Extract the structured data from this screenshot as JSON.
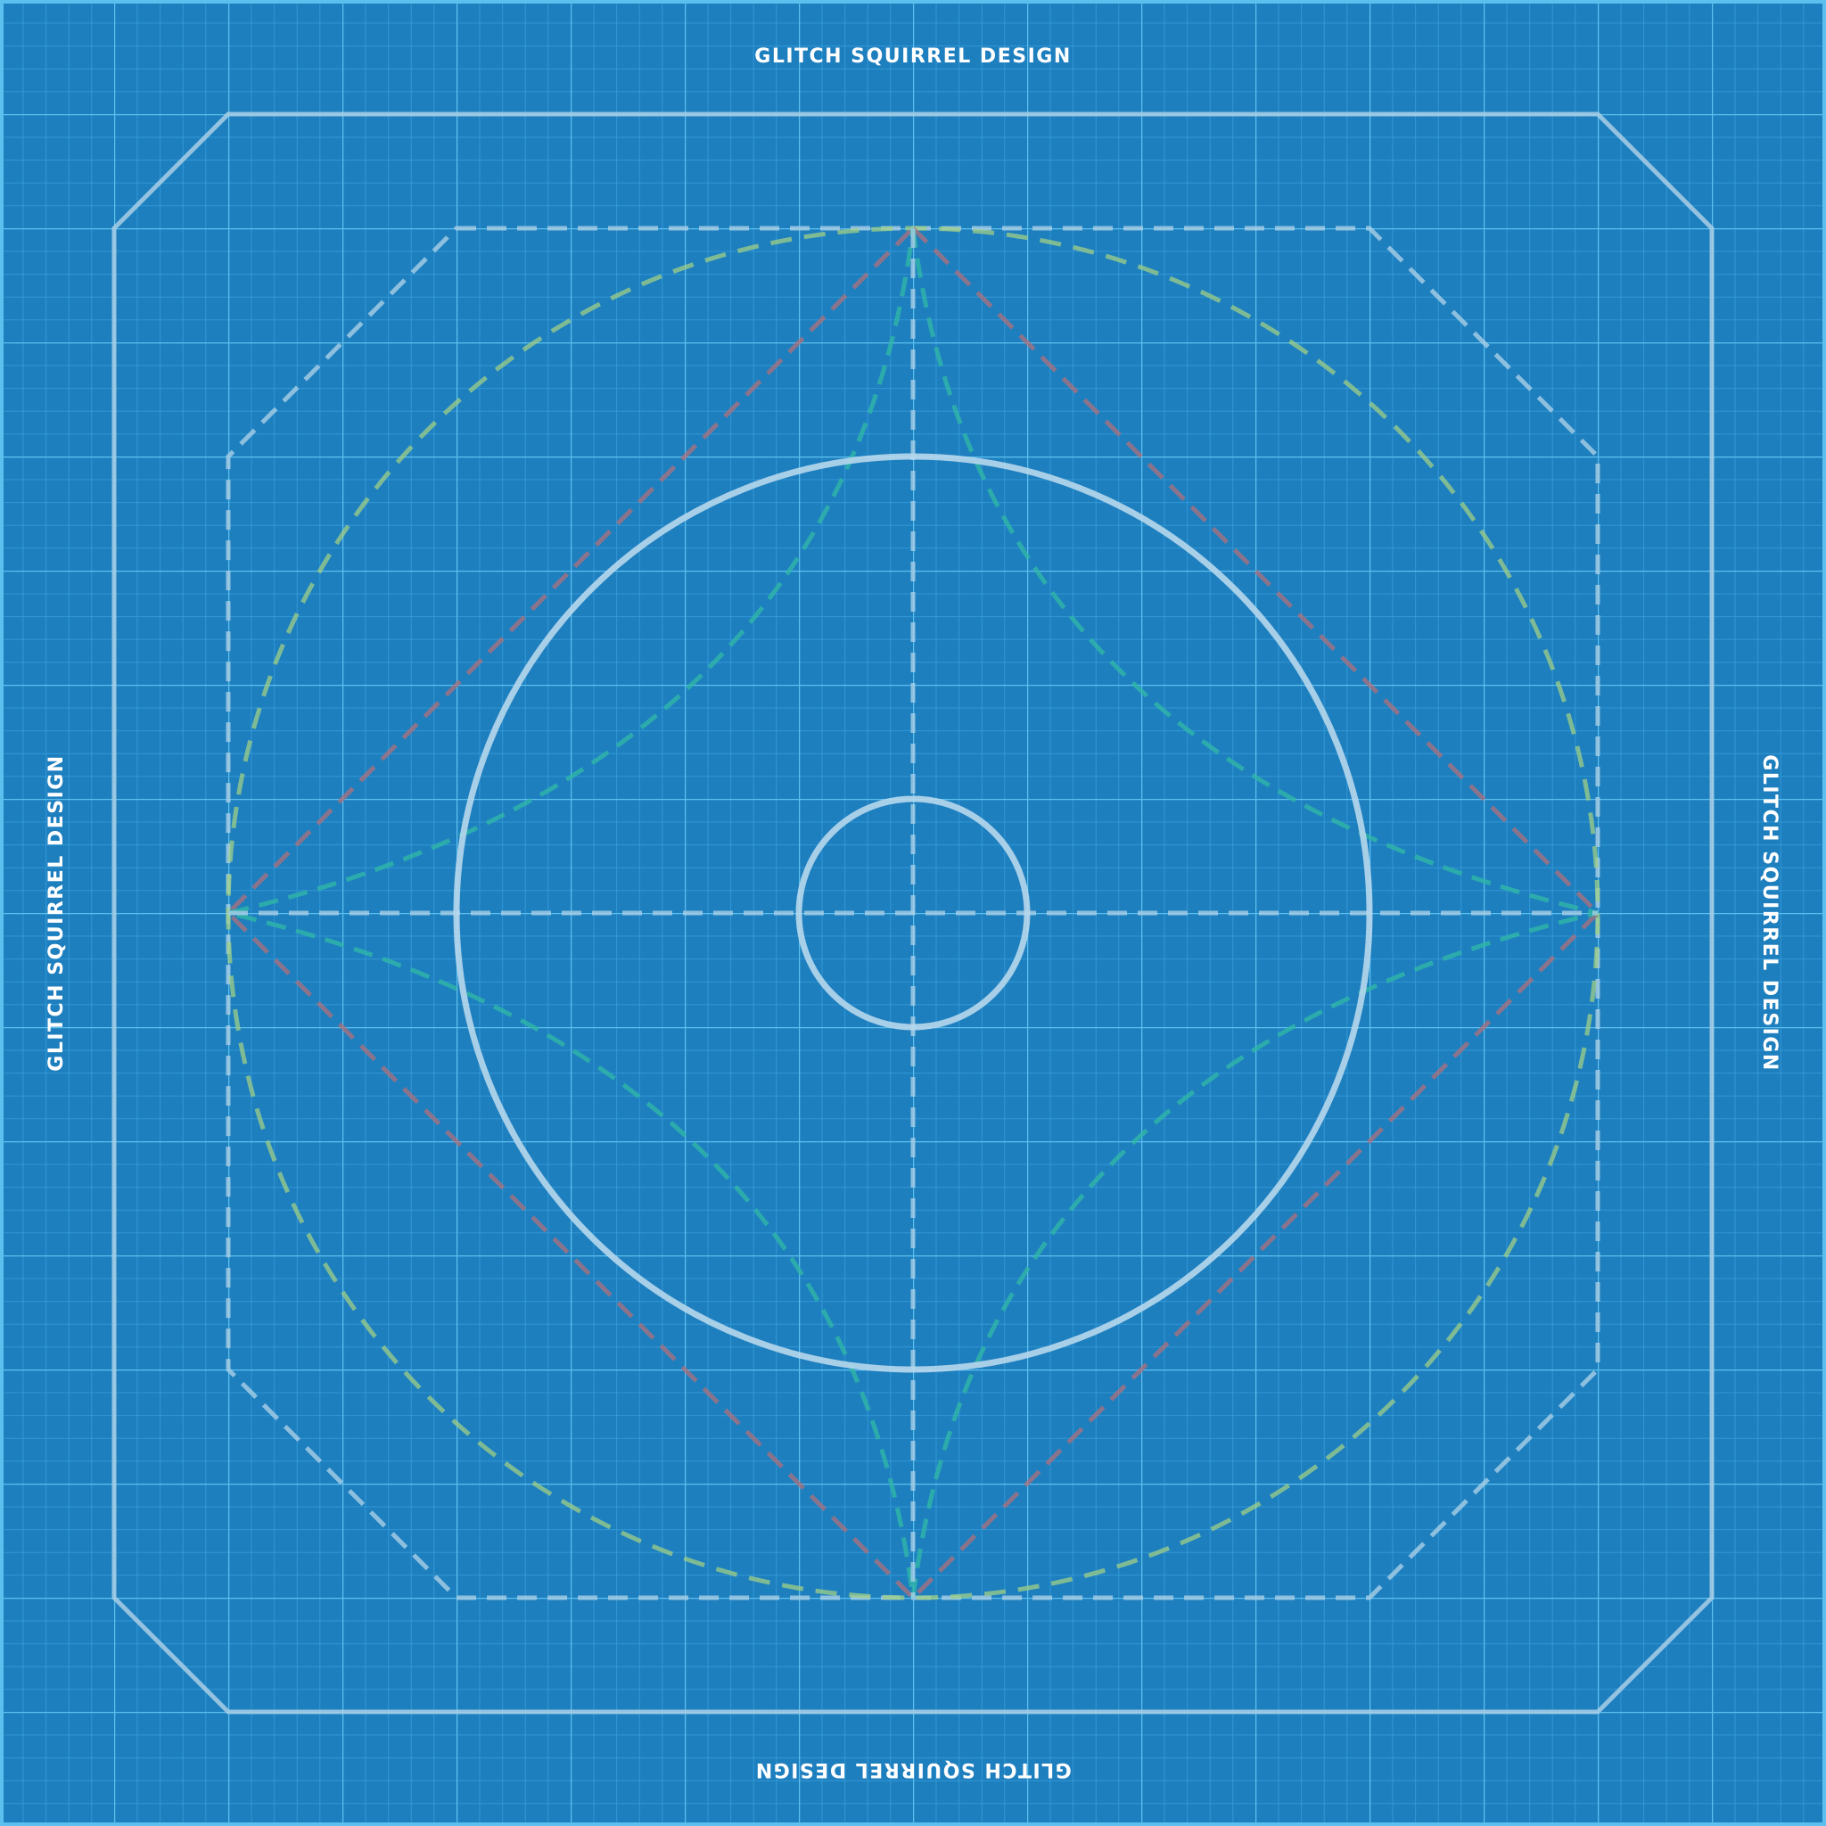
{
  "mat": {
    "brand_top": "GLITCH SQUIRREL DESIGN",
    "brand_bottom": "GLITCH SQUIRREL DESIGN",
    "brand_left": "GLITCH SQUIRREL DESIGN",
    "brand_right": "GLITCH SQUIRREL DESIGN",
    "colors": {
      "background": "#1e7fbf",
      "grid_minor": "#3aa3df",
      "grid_major": "#5cc0ee",
      "outline": "#a9cfe6",
      "dashed_outline": "#a9cfe6",
      "circle_dashed": "#9fcf86",
      "diamond_lines": "#b0707a",
      "star_lines": "#2fb6a8",
      "text": "#ffffff"
    },
    "icons": [
      "octagon-outline",
      "inner-octagon-dashed",
      "circle-large-dashed",
      "circle-medium",
      "circle-small",
      "diamond",
      "four-point-star",
      "crosshair"
    ]
  }
}
